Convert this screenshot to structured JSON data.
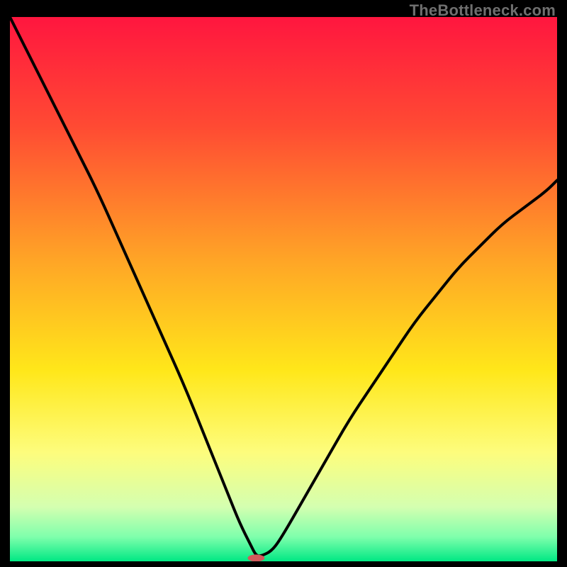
{
  "watermark": "TheBottleneck.com",
  "chart_data": {
    "type": "line",
    "title": "",
    "xlabel": "",
    "ylabel": "",
    "xlim": [
      0,
      100
    ],
    "ylim": [
      0,
      100
    ],
    "grid": false,
    "legend": false,
    "background_gradient_stops": [
      {
        "offset": 0.0,
        "color": "#ff163f"
      },
      {
        "offset": 0.2,
        "color": "#ff4a33"
      },
      {
        "offset": 0.45,
        "color": "#ffa626"
      },
      {
        "offset": 0.65,
        "color": "#ffe71a"
      },
      {
        "offset": 0.8,
        "color": "#fdfd7d"
      },
      {
        "offset": 0.9,
        "color": "#d4ffb0"
      },
      {
        "offset": 0.955,
        "color": "#7fffac"
      },
      {
        "offset": 1.0,
        "color": "#00e884"
      }
    ],
    "series": [
      {
        "name": "bottleneck-curve",
        "x": [
          0,
          4,
          8,
          12,
          16,
          20,
          24,
          28,
          32,
          36,
          40,
          42,
          44,
          45,
          46,
          48,
          50,
          54,
          58,
          62,
          66,
          70,
          74,
          78,
          82,
          86,
          90,
          94,
          98,
          100
        ],
        "y": [
          100,
          92,
          84,
          76,
          68,
          59,
          50,
          41,
          32,
          22,
          12,
          7,
          3,
          1,
          1,
          2,
          5,
          12,
          19,
          26,
          32,
          38,
          44,
          49,
          54,
          58,
          62,
          65,
          68,
          70
        ]
      }
    ],
    "marker": {
      "name": "optimal-point",
      "x": 45,
      "y": 0.6,
      "color": "#d2595c",
      "rx": 12,
      "ry": 5
    }
  }
}
